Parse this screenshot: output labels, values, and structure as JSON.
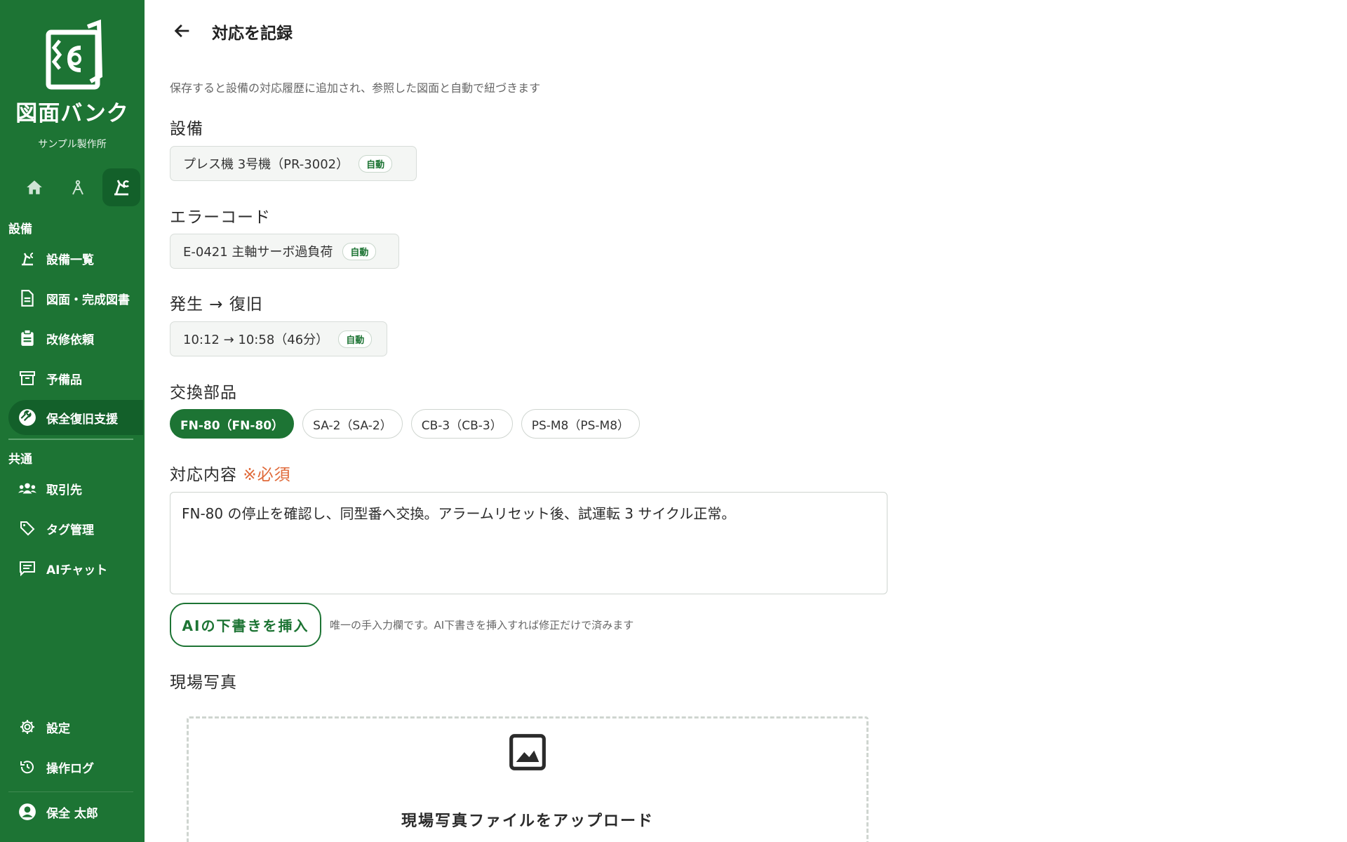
{
  "sidebar": {
    "brand": "図面バンク",
    "company": "サンプル製作所",
    "section_equipment": "設備",
    "section_common": "共通",
    "items_equipment": [
      {
        "label": "設備一覧",
        "icon": "machine-icon"
      },
      {
        "label": "図面・完成図書",
        "icon": "document-icon"
      },
      {
        "label": "改修依頼",
        "icon": "clipboard-icon"
      },
      {
        "label": "予備品",
        "icon": "archive-box-icon"
      },
      {
        "label": "保全復旧支援",
        "icon": "wrench-icon",
        "active": true
      }
    ],
    "items_common": [
      {
        "label": "取引先",
        "icon": "people-icon"
      },
      {
        "label": "タグ管理",
        "icon": "tag-icon"
      },
      {
        "label": "AIチャット",
        "icon": "chat-icon"
      }
    ],
    "settings": "設定",
    "operation_log": "操作ログ",
    "user_name": "保全 太郎"
  },
  "header": {
    "title": "対応を記録"
  },
  "form": {
    "subtitle": "保存すると設備の対応履歴に追加され、参照した図面と自動で紐づきます",
    "equipment_label": "設備",
    "equipment_value": "プレス機 3号機（PR-3002）",
    "error_code_label": "エラーコード",
    "error_code_value": "E-0421 主軸サーボ過負荷",
    "time_label": "発生 → 復旧",
    "time_value": "10:12 → 10:58（46分）",
    "auto_badge": "自動",
    "parts_label": "交換部品",
    "parts": [
      {
        "label": "FN-80（FN-80）",
        "selected": true
      },
      {
        "label": "SA-2（SA-2）",
        "selected": false
      },
      {
        "label": "CB-3（CB-3）",
        "selected": false
      },
      {
        "label": "PS-M8（PS-M8）",
        "selected": false
      }
    ],
    "content_label": "対応内容",
    "required_mark": "※必須",
    "content_value": "FN-80 の停止を確認し、同型番へ交換。アラームリセット後、試運転 3 サイクル正常。",
    "ai_button": "AIの下書きを挿入",
    "ai_hint": "唯一の手入力欄です。AI下書きを挿入すれば修正だけで済みます",
    "photo_label": "現場写真",
    "upload_text": "現場写真ファイルをアップロード"
  },
  "colors": {
    "brand_green": "#1d7434",
    "active_green": "#13602a",
    "required_orange": "#e06a3a"
  }
}
